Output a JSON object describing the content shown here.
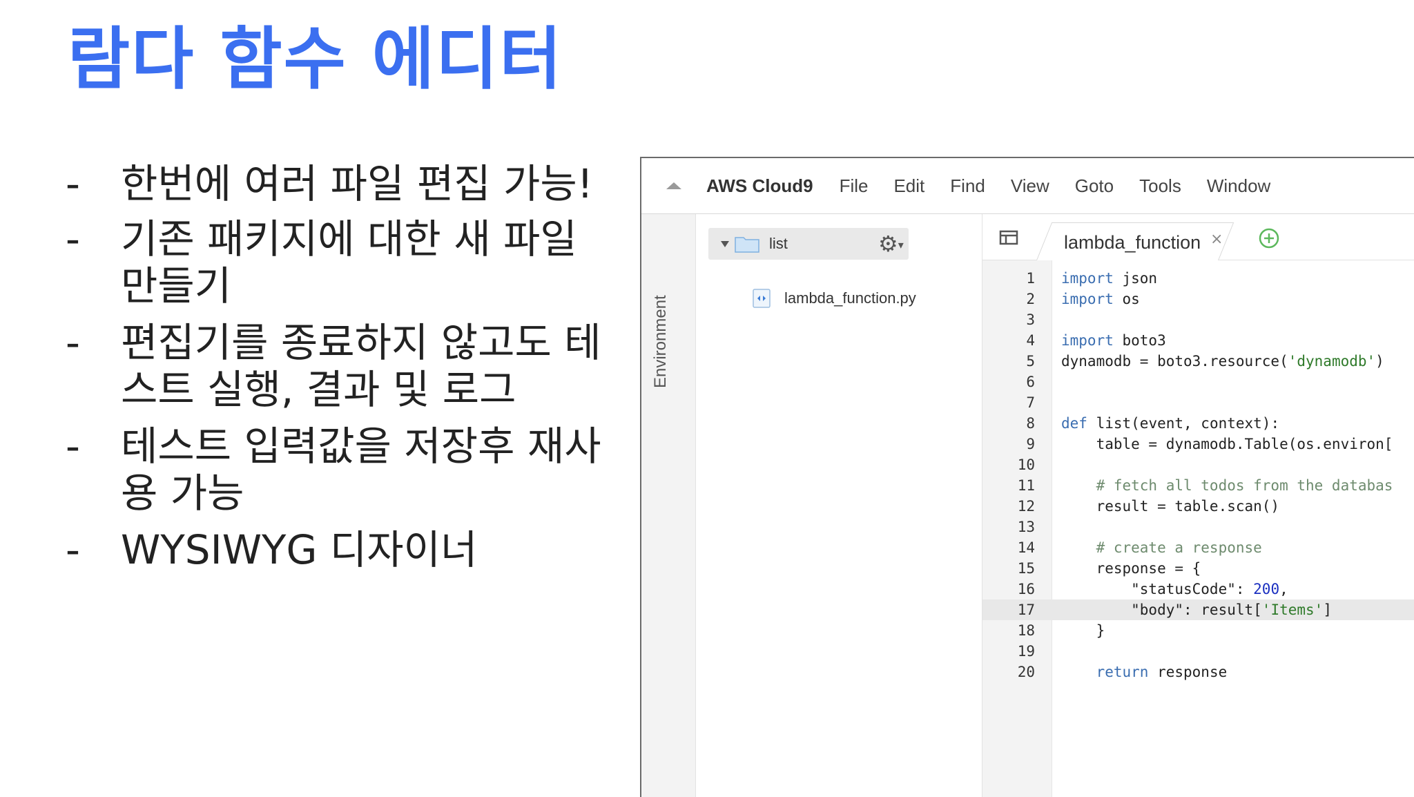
{
  "slide": {
    "title": "람다 함수 에디터",
    "bullets": [
      {
        "dash": "-",
        "text": "한번에 여러 파일 편집 가능!"
      },
      {
        "dash": "-",
        "text": "기존 패키지에 대한 새 파일 만들기"
      },
      {
        "dash": "-",
        "text": "편집기를 종료하지 않고도 테스트 실행, 결과 및 로그"
      },
      {
        "dash": "-",
        "text": "테스트 입력값을 저장후 재사용 가능"
      },
      {
        "dash": "-",
        "text": "WYSIWYG 디자이너"
      }
    ]
  },
  "ide": {
    "menu": {
      "brand": "AWS Cloud9",
      "items": [
        "File",
        "Edit",
        "Find",
        "View",
        "Goto",
        "Tools",
        "Window"
      ]
    },
    "environment_label": "Environment",
    "tree": {
      "root_folder": "list",
      "files": [
        "lambda_function.py"
      ]
    },
    "tab": {
      "label": "lambda_function",
      "close_glyph": "×"
    },
    "active_line": 17,
    "code": [
      {
        "n": "1",
        "tokens": [
          {
            "t": "import",
            "c": "kw"
          },
          {
            "t": " json",
            "c": ""
          }
        ]
      },
      {
        "n": "2",
        "tokens": [
          {
            "t": "import",
            "c": "kw"
          },
          {
            "t": " os",
            "c": ""
          }
        ]
      },
      {
        "n": "3",
        "tokens": []
      },
      {
        "n": "4",
        "tokens": [
          {
            "t": "import",
            "c": "kw"
          },
          {
            "t": " boto3",
            "c": ""
          }
        ]
      },
      {
        "n": "5",
        "tokens": [
          {
            "t": "dynamodb = boto3.resource(",
            "c": ""
          },
          {
            "t": "'dynamodb'",
            "c": "str"
          },
          {
            "t": ")",
            "c": ""
          }
        ]
      },
      {
        "n": "6",
        "tokens": []
      },
      {
        "n": "7",
        "tokens": []
      },
      {
        "n": "8",
        "tokens": [
          {
            "t": "def",
            "c": "kw"
          },
          {
            "t": " list(event, context):",
            "c": ""
          }
        ]
      },
      {
        "n": "9",
        "tokens": [
          {
            "t": "    table = dynamodb.Table(os.environ[",
            "c": ""
          }
        ]
      },
      {
        "n": "10",
        "tokens": []
      },
      {
        "n": "11",
        "tokens": [
          {
            "t": "    # fetch all todos from the databas",
            "c": "com"
          }
        ]
      },
      {
        "n": "12",
        "tokens": [
          {
            "t": "    result = table.scan()",
            "c": ""
          }
        ]
      },
      {
        "n": "13",
        "tokens": []
      },
      {
        "n": "14",
        "tokens": [
          {
            "t": "    # create a response",
            "c": "com"
          }
        ]
      },
      {
        "n": "15",
        "tokens": [
          {
            "t": "    response = {",
            "c": ""
          }
        ]
      },
      {
        "n": "16",
        "tokens": [
          {
            "t": "        \"statusCode\": ",
            "c": ""
          },
          {
            "t": "200",
            "c": "num"
          },
          {
            "t": ",",
            "c": ""
          }
        ]
      },
      {
        "n": "17",
        "tokens": [
          {
            "t": "        \"body\": result[",
            "c": ""
          },
          {
            "t": "'Items'",
            "c": "str"
          },
          {
            "t": "]",
            "c": ""
          }
        ]
      },
      {
        "n": "18",
        "tokens": [
          {
            "t": "    }",
            "c": ""
          }
        ]
      },
      {
        "n": "19",
        "tokens": []
      },
      {
        "n": "20",
        "tokens": [
          {
            "t": "    ",
            "c": ""
          },
          {
            "t": "return",
            "c": "kw"
          },
          {
            "t": " response",
            "c": ""
          }
        ]
      }
    ]
  }
}
